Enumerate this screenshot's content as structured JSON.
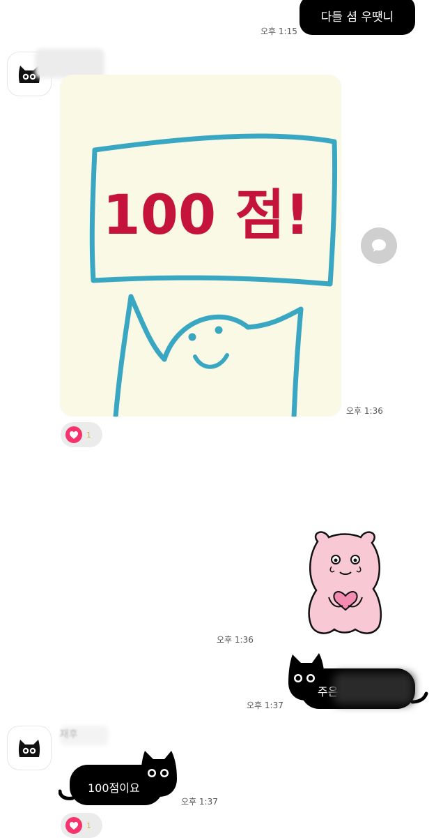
{
  "messages": {
    "out_1": {
      "text": "다들 셤 우땟니",
      "time": "오후 1:15"
    },
    "in_photo": {
      "time": "오후 1:36",
      "sign_text": "100 점!",
      "reaction_count": "1"
    },
    "out_sticker": {
      "time": "오후 1:36"
    },
    "out_cat": {
      "text": "주은",
      "time": "오후 1:37"
    },
    "in_cat": {
      "sender": "재후",
      "text": "100점이요",
      "time": "오후 1:37",
      "reaction_count": "1"
    }
  },
  "colors": {
    "bubble_out": "#000000",
    "heart": "#f7336e",
    "sign_border": "#3aa7c2",
    "sign_text": "#c4143e"
  },
  "icons": {
    "avatar": "black-cat-icon",
    "reaction": "heart-icon",
    "share": "speech-bubble-icon"
  }
}
